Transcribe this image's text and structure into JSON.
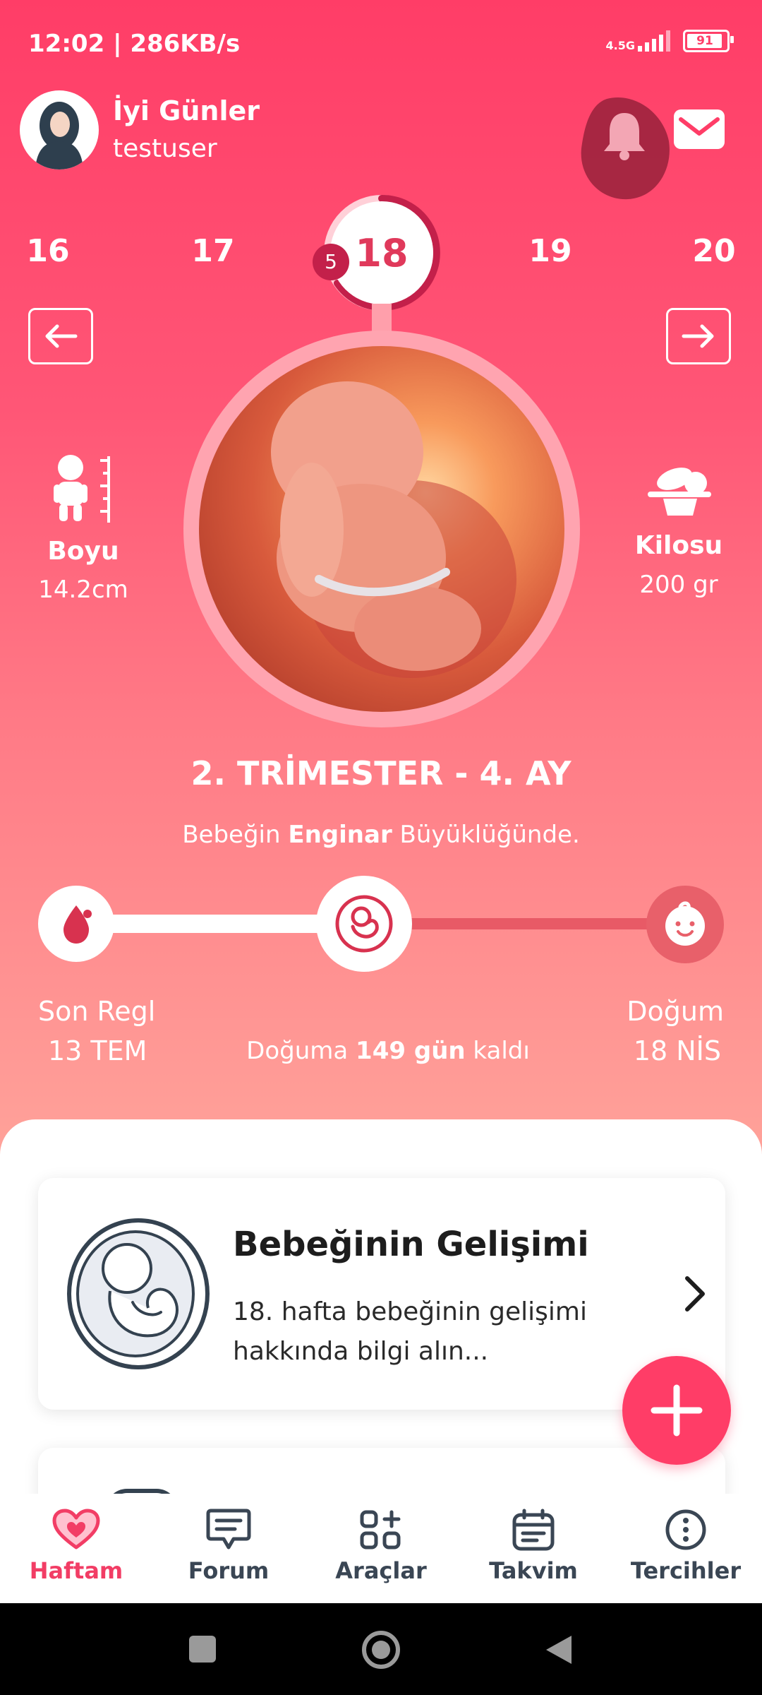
{
  "status_bar": {
    "time": "12:02 | 286KB/s",
    "network": "4.5G",
    "battery": "91"
  },
  "header": {
    "greeting": "İyi Günler",
    "username": "testuser",
    "icons": [
      "bell-icon",
      "mail-icon"
    ]
  },
  "weeks": {
    "items": [
      "16",
      "17",
      "18",
      "19",
      "20"
    ],
    "current": "18",
    "days_badge": "5"
  },
  "baby": {
    "length_label": "Boyu",
    "length_value": "14.2cm",
    "weight_label": "Kilosu",
    "weight_value": "200 gr"
  },
  "trimester": "2. TRİMESTER - 4. AY",
  "size_line": {
    "prefix": "Bebeğin",
    "fruit": "Enginar",
    "suffix": "Büyüklüğünde."
  },
  "timeline": {
    "start_label": "Son Regl",
    "start_date": "13 TEM",
    "end_label": "Doğum",
    "end_date": "18 NİS",
    "remaining_prefix": "Doğuma",
    "remaining_bold": "149 gün",
    "remaining_suffix": "kaldı"
  },
  "card": {
    "title": "Bebeğinin Gelişimi",
    "description": "18. hafta bebeğinin gelişimi hakkında bilgi alın..."
  },
  "tabs": [
    {
      "label": "Haftam",
      "icon": "heart-icon",
      "active": true
    },
    {
      "label": "Forum",
      "icon": "chat-icon"
    },
    {
      "label": "Araçlar",
      "icon": "tools-icon"
    },
    {
      "label": "Takvim",
      "icon": "calendar-icon"
    },
    {
      "label": "Tercihler",
      "icon": "more-icon"
    }
  ],
  "colors": {
    "accent": "#ff3d67",
    "tab_active": "#f23d65",
    "tab_inactive": "#3a4654"
  }
}
